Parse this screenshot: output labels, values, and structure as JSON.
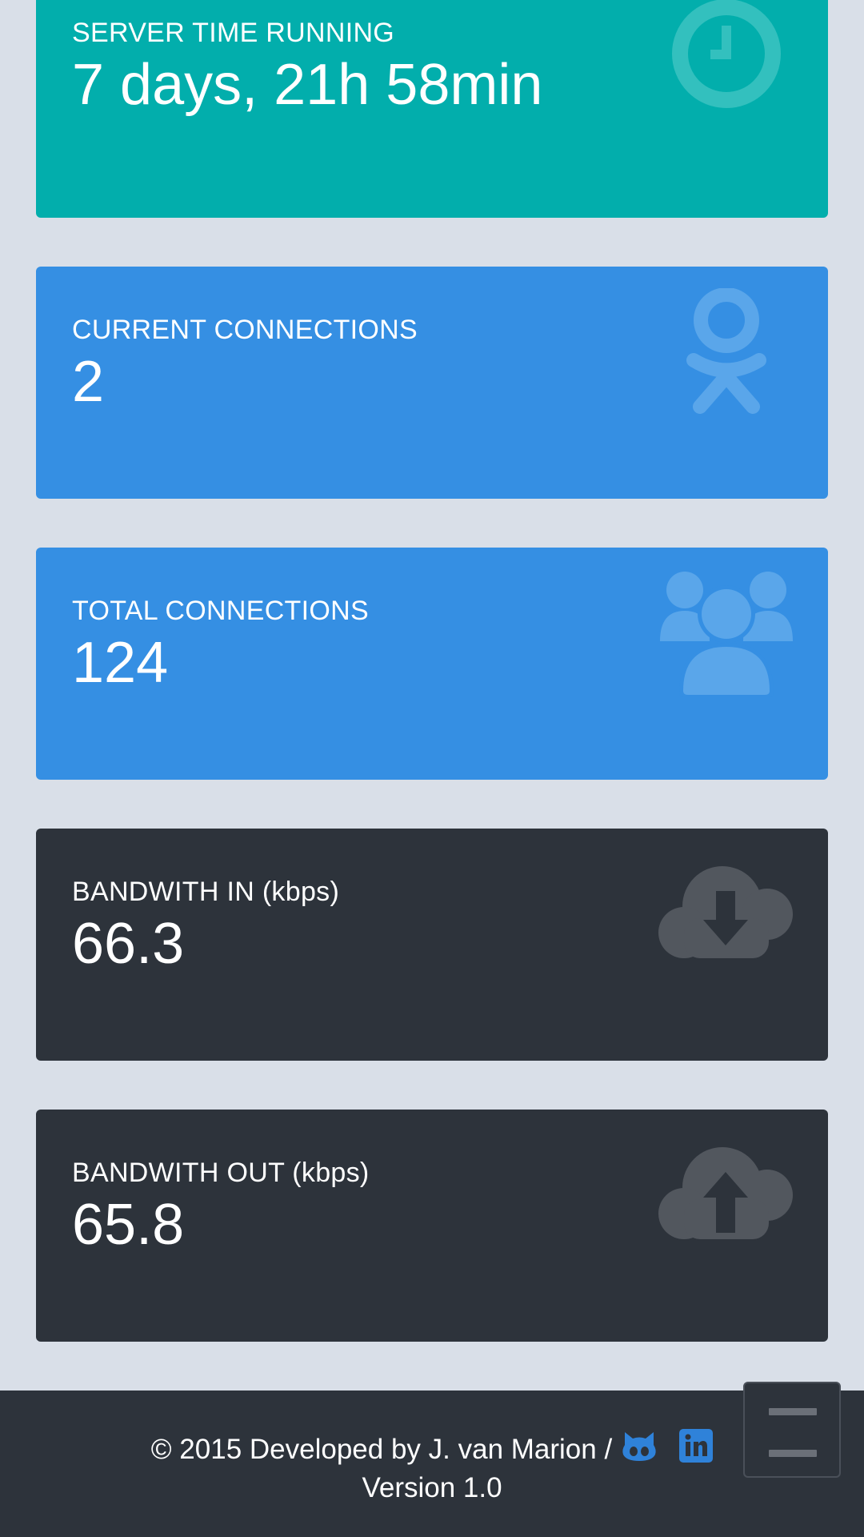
{
  "cards": {
    "uptime": {
      "label": "SERVER TIME RUNNING",
      "value": "7 days, 21h 58min",
      "icon": "clock-icon",
      "color": "#02aeac"
    },
    "current_connections": {
      "label": "CURRENT CONNECTIONS",
      "value": "2",
      "icon": "odnoklassniki-person-icon",
      "color": "#358fe3"
    },
    "total_connections": {
      "label": "TOTAL CONNECTIONS",
      "value": "124",
      "icon": "users-group-icon",
      "color": "#358fe3"
    },
    "bandwidth_in": {
      "label": "BANDWITH IN (kbps)",
      "value": "66.3",
      "icon": "cloud-download-icon",
      "color": "#2d333b"
    },
    "bandwidth_out": {
      "label": "BANDWITH OUT (kbps)",
      "value": "65.8",
      "icon": "cloud-upload-icon",
      "color": "#2d333b"
    }
  },
  "footer": {
    "credit": "© 2015 Developed by J. van Marion /",
    "version": "Version 1.0",
    "links": [
      "github-icon",
      "linkedin-icon"
    ]
  },
  "menu_button": {
    "icon": "hamburger-menu-icon"
  },
  "colors": {
    "background": "#d9dfe8",
    "link_blue": "#2f82d9"
  }
}
